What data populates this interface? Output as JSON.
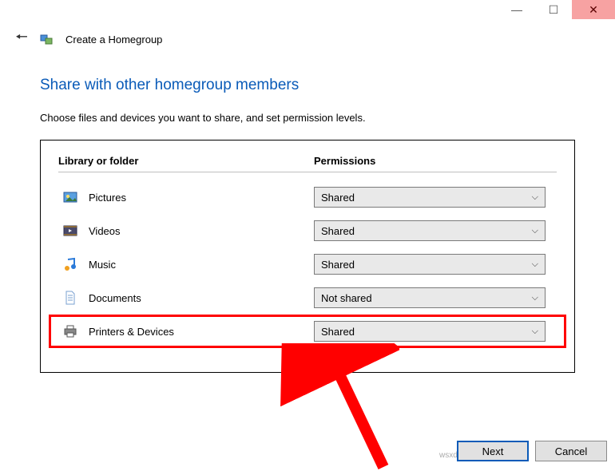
{
  "window": {
    "title": "Create a Homegroup",
    "min_icon": "—",
    "max_icon": "☐",
    "close_icon": "✕"
  },
  "page": {
    "title": "Share with other homegroup members",
    "instruction": "Choose files and devices you want to share, and set permission levels."
  },
  "table": {
    "header_lib": "Library or folder",
    "header_perm": "Permissions",
    "rows": [
      {
        "label": "Pictures",
        "value": "Shared"
      },
      {
        "label": "Videos",
        "value": "Shared"
      },
      {
        "label": "Music",
        "value": "Shared"
      },
      {
        "label": "Documents",
        "value": "Not shared"
      },
      {
        "label": "Printers & Devices",
        "value": "Shared"
      }
    ]
  },
  "footer": {
    "next": "Next",
    "cancel": "Cancel"
  },
  "watermark": "wsxdn.com"
}
